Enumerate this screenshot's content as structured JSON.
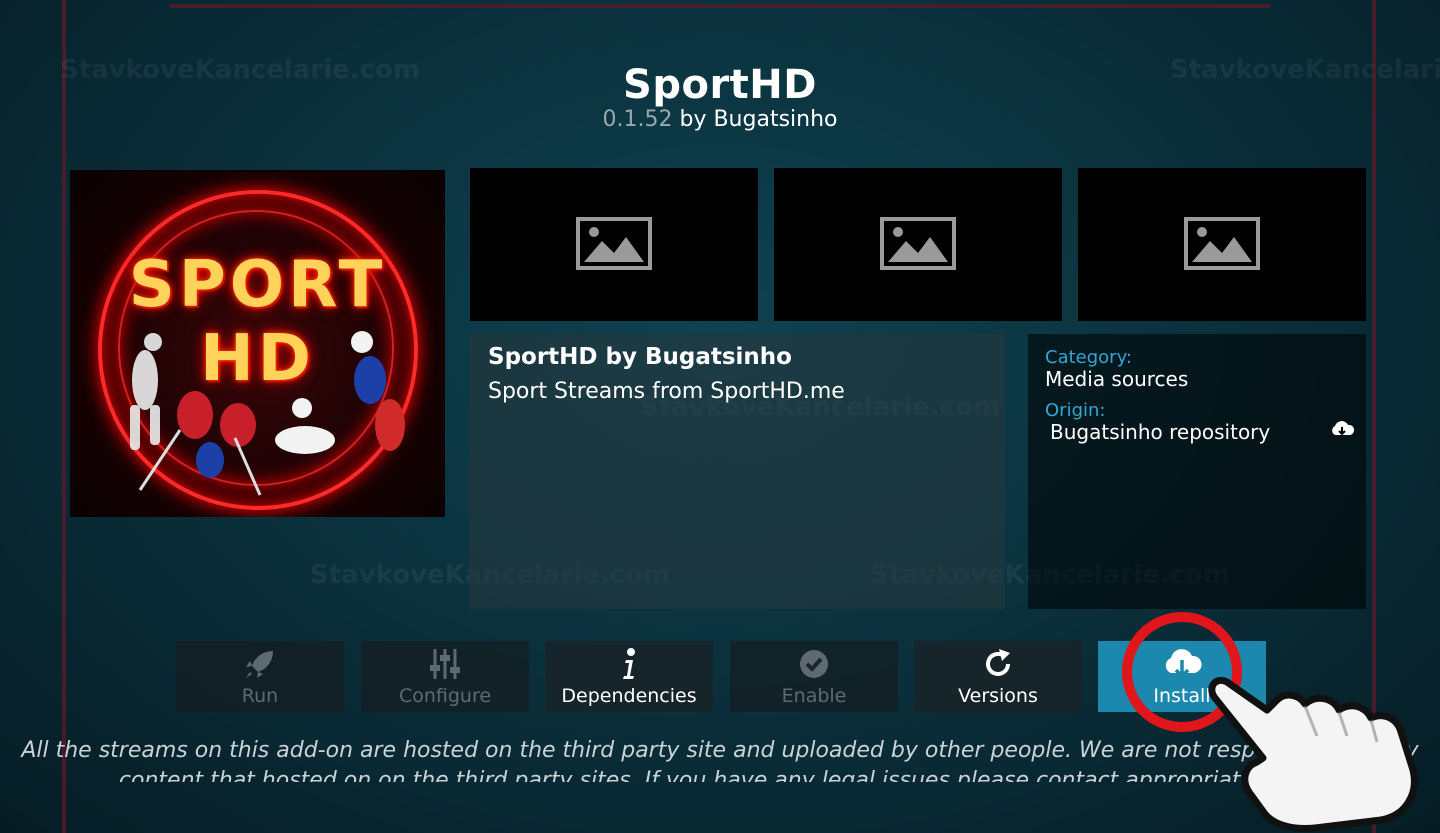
{
  "addon": {
    "title": "SportHD",
    "version": "0.1.52",
    "author_line": "by Bugatsinho",
    "poster_text": "SPORT HD"
  },
  "description": {
    "title": "SportHD by Bugatsinho",
    "summary": "Sport Streams from SportHD.me"
  },
  "info": {
    "category_label": "Category:",
    "category_value": "Media sources",
    "origin_label": "Origin:",
    "origin_value": "Bugatsinho repository",
    "origin_icon": "cloud-download-icon"
  },
  "buttons": [
    {
      "label": "Run",
      "icon": "rocket-icon",
      "enabled": false
    },
    {
      "label": "Configure",
      "icon": "sliders-icon",
      "enabled": false
    },
    {
      "label": "Dependencies",
      "icon": "info-icon",
      "enabled": true
    },
    {
      "label": "Enable",
      "icon": "check-circle-icon",
      "enabled": false
    },
    {
      "label": "Versions",
      "icon": "refresh-icon",
      "enabled": true
    },
    {
      "label": "Install",
      "icon": "cloud-download-icon",
      "enabled": true,
      "focused": true
    }
  ],
  "disclaimer": "All the streams on this add-on are hosted on the third party site and uploaded by other people. We are not responsible for any content that hosted on on the third party sites. If you have any legal issues please contact appropriate video",
  "watermark": "StavkoveKancelarie.com",
  "colors": {
    "accent": "#1c88ad",
    "label_blue": "#33a6d6",
    "highlight_red": "#e0161b"
  }
}
